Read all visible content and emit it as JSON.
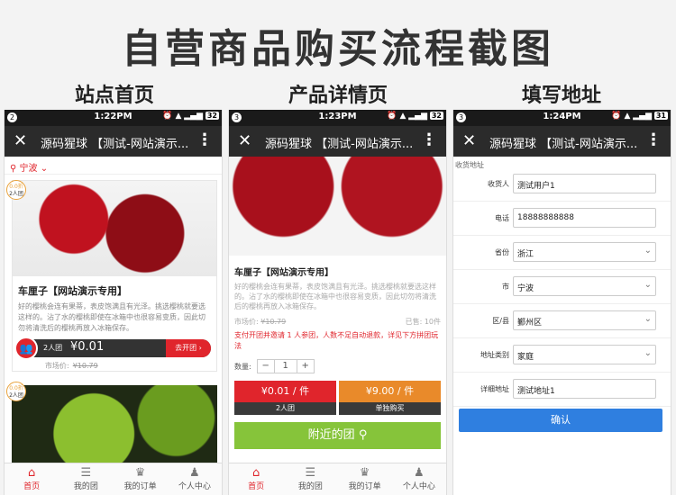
{
  "page": {
    "title": "自营商品购买流程截图",
    "columns": [
      "站点首页",
      "产品详情页",
      "填写地址"
    ]
  },
  "phones": [
    {
      "notif": "2",
      "time": "1:22PM",
      "battery": "32",
      "title": "源码猩球 【测试-网站演示..."
    },
    {
      "notif": "3",
      "time": "1:23PM",
      "battery": "32",
      "title": "源码猩球 【测试-网站演示..."
    },
    {
      "notif": "3",
      "time": "1:24PM",
      "battery": "31",
      "title": "源码猩球 【测试-网站演示..."
    }
  ],
  "tabbar": [
    "首页",
    "我的团",
    "我的订单",
    "个人中心"
  ],
  "home": {
    "location": "宁波",
    "badge_line1": "0.0折",
    "badge_line2": "2人团",
    "product_name": "车厘子【网站演示专用】",
    "product_desc": "好的樱桃会连有果蒂，表皮饱满且有光泽。挑选樱桃就要选这样的。沾了水的樱桃即使在冰箱中也很容易变质，因此切勿将清洗后的樱桃再放入冰箱保存。",
    "group_size": "2人团",
    "group_price": "¥0.01",
    "group_button": "去开团",
    "market_price_label": "市场价:",
    "market_price": "¥10.79",
    "badge2_line1": "0.0折",
    "badge2_line2": "2人团"
  },
  "detail": {
    "product_name": "车厘子【网站演示专用】",
    "product_desc": "好的樱桃会连有果蒂，表皮饱满且有光泽。挑选樱桃就要选这样的。沾了水的樱桃即使在冰箱中也很容易变质，因此切勿将清洗后的樱桃再放入冰箱保存。",
    "market_price_label": "市场价:",
    "market_price": "¥10.79",
    "stock": "已售: 10件",
    "rule": "支付开团并邀请 1 人参团，人数不足自动退款，详见下方拼团玩法",
    "qty_label": "数量:",
    "qty_minus": "−",
    "qty_value": "1",
    "qty_plus": "+",
    "group_price": "¥0.01 / 件",
    "group_label": "2人团",
    "solo_price": "¥9.00 / 件",
    "solo_label": "单独购买",
    "nearby": "附近的团"
  },
  "address": {
    "section": "收货地址",
    "fields": [
      {
        "label": "收货人",
        "value": "测试用户1"
      },
      {
        "label": "电话",
        "value": "18888888888"
      },
      {
        "label": "省份",
        "value": "浙江"
      },
      {
        "label": "市",
        "value": "宁波"
      },
      {
        "label": "区/县",
        "value": "鄞州区"
      },
      {
        "label": "地址类别",
        "value": "家庭"
      },
      {
        "label": "详细地址",
        "value": "测试地址1"
      }
    ],
    "confirm": "确认"
  },
  "colors": {
    "accent_red": "#e0252c",
    "green": "#86c43a",
    "blue": "#2f7fe0",
    "orange": "#e98a2a"
  }
}
